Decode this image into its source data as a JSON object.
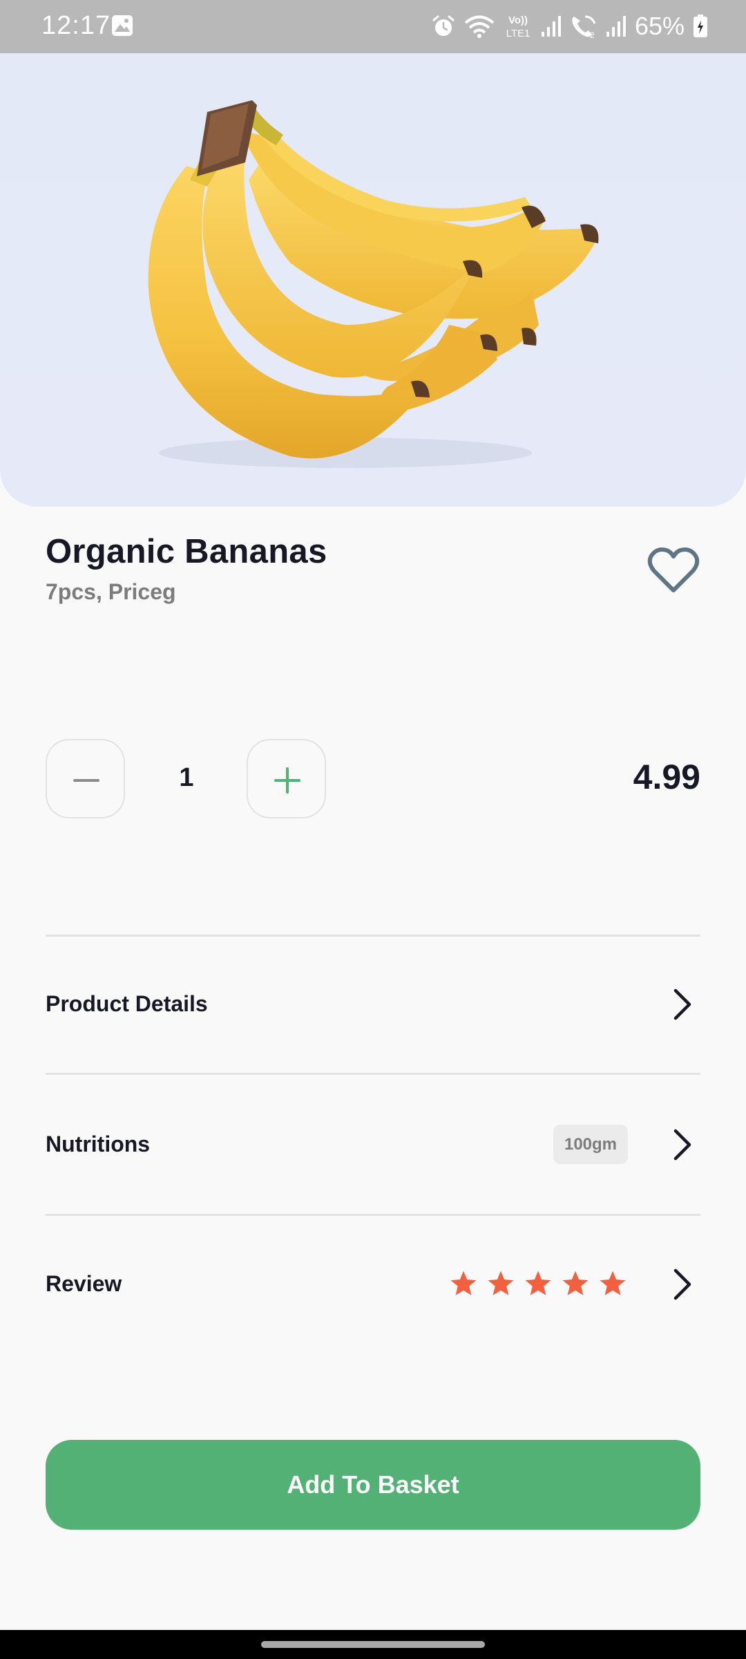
{
  "status_bar": {
    "time": "12:17",
    "battery": "65%",
    "network_label": "Vo)) LTE1"
  },
  "product": {
    "image_icon": "banana-bunch-image",
    "title": "Organic Bananas",
    "subtitle": "7pcs, Priceg",
    "favorite_icon": "heart-outline-icon",
    "quantity": "1",
    "price": "4.99"
  },
  "details": {
    "product_details_label": "Product Details",
    "nutritions_label": "Nutritions",
    "nutritions_badge": "100gm",
    "review_label": "Review",
    "review_rating": 5,
    "review_max": 5
  },
  "actions": {
    "add_to_basket_label": "Add To Basket"
  },
  "colors": {
    "accent": "#53b175",
    "star": "#f3603f",
    "text": "#181725",
    "muted": "#7c7c7c"
  }
}
